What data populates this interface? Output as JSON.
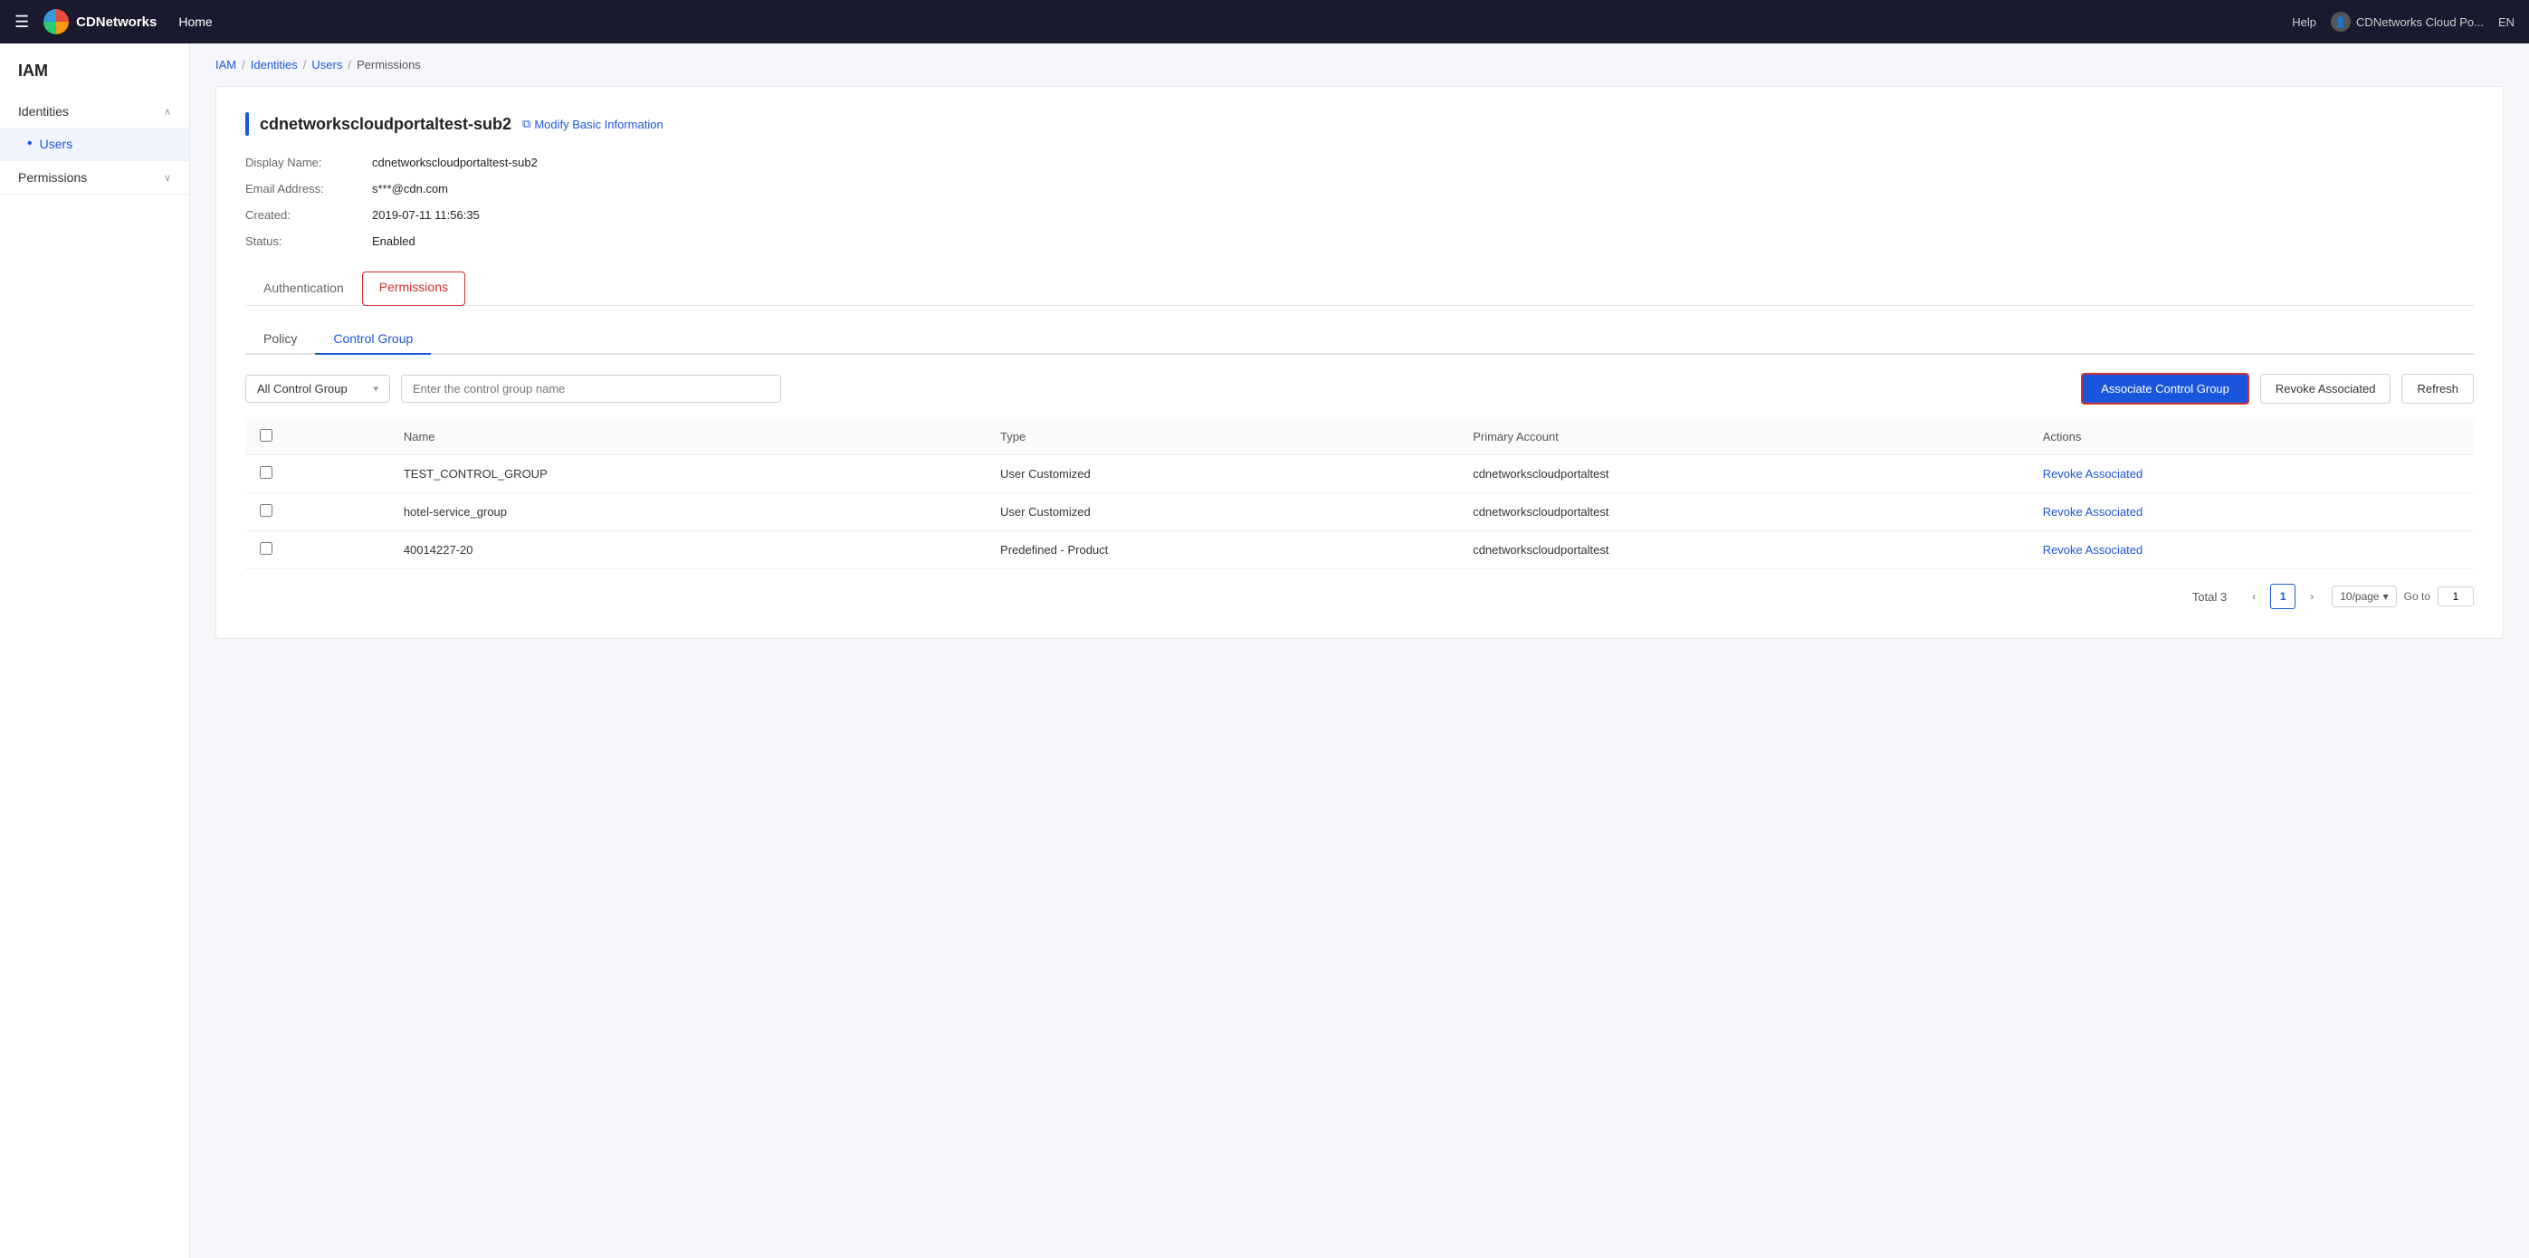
{
  "topNav": {
    "menuIcon": "☰",
    "logoAlt": "CDNetworks",
    "homeLabel": "Home",
    "helpLabel": "Help",
    "userLabel": "CDNetworks Cloud Po...",
    "langLabel": "EN"
  },
  "sidebar": {
    "title": "IAM",
    "groups": [
      {
        "label": "Identities",
        "expanded": true,
        "items": [
          {
            "label": "Users",
            "active": true
          }
        ]
      },
      {
        "label": "Permissions",
        "expanded": false,
        "items": []
      }
    ]
  },
  "breadcrumb": {
    "items": [
      "IAM",
      "Identities",
      "Users",
      "Permissions"
    ],
    "links": [
      true,
      true,
      true,
      false
    ]
  },
  "userDetail": {
    "name": "cdnetworkscloudportaltest-sub2",
    "modifyLabel": "Modify Basic Information",
    "fields": [
      {
        "label": "Display Name:",
        "value": "cdnetworkscloudportaltest-sub2"
      },
      {
        "label": "Email Address:",
        "value": "s***@cdn.com"
      },
      {
        "label": "Created:",
        "value": "2019-07-11 11:56:35"
      },
      {
        "label": "Status:",
        "value": "Enabled"
      }
    ]
  },
  "tabs": {
    "items": [
      {
        "label": "Authentication",
        "active": false,
        "highlighted": false
      },
      {
        "label": "Permissions",
        "active": true,
        "highlighted": true
      }
    ]
  },
  "subTabs": {
    "items": [
      {
        "label": "Policy",
        "active": false
      },
      {
        "label": "Control Group",
        "active": true
      }
    ]
  },
  "toolbar": {
    "dropdownLabel": "All Control Group",
    "searchPlaceholder": "Enter the control group name",
    "associateLabel": "Associate Control Group",
    "revokeLabel": "Revoke Associated",
    "refreshLabel": "Refresh"
  },
  "table": {
    "columns": [
      "",
      "Name",
      "Type",
      "Primary Account",
      "Actions"
    ],
    "rows": [
      {
        "name": "TEST_CONTROL_GROUP",
        "type": "User Customized",
        "primaryAccount": "cdnetworkscloudportaltest",
        "actionLabel": "Revoke Associated"
      },
      {
        "name": "hotel-service_group",
        "type": "User Customized",
        "primaryAccount": "cdnetworkscloudportaltest",
        "actionLabel": "Revoke Associated"
      },
      {
        "name": "40014227-20",
        "type": "Predefined - Product",
        "primaryAccount": "cdnetworkscloudportaltest",
        "actionLabel": "Revoke Associated"
      }
    ]
  },
  "pagination": {
    "totalLabel": "Total",
    "totalCount": "3",
    "currentPage": "1",
    "perPageLabel": "10/page",
    "gotoLabel": "Go to",
    "gotoValue": "1"
  }
}
